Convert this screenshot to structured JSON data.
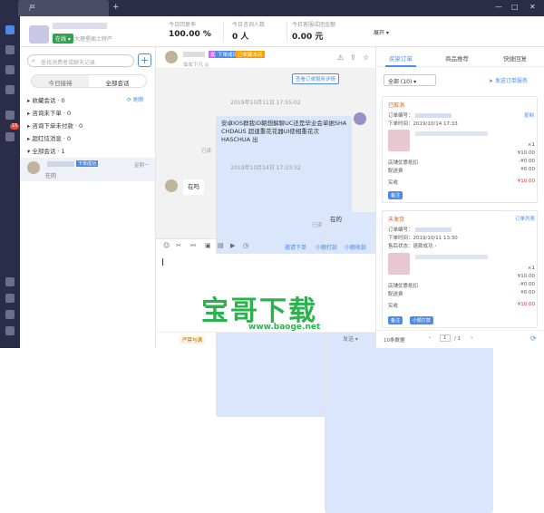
{
  "titlebar": {
    "tab_title": "严",
    "tab_plus": "+",
    "min": "—",
    "max": "□",
    "close": "✕"
  },
  "header": {
    "status": "在线 ▾",
    "shop_sub": "大理堡阁土特产",
    "stats": [
      {
        "label": "今日回复率",
        "value": "100.00 %"
      },
      {
        "label": "今日咨询人数",
        "value": "0 人"
      },
      {
        "label": "今日客服成团金额",
        "value": "0.00 元"
      }
    ],
    "expand": "展开 ▾"
  },
  "left": {
    "search_placeholder": "查找消费者或聊天记录",
    "add": "+",
    "seg": [
      "今日接待",
      "全部会话"
    ],
    "groups": [
      "▸ 收藏会话 · 0",
      "▸ 咨询未下单 · 0",
      "▸ 咨询下单未付款 · 0",
      "▸ 超红炫消息 · 0",
      "▾ 全部会话 · 1"
    ],
    "refresh": "⟳ 刷新",
    "conv": {
      "tag": "下单成功",
      "time": "星期一",
      "msg": "在的"
    }
  },
  "chat": {
    "tag1": "女",
    "tag2": "下单成功",
    "tag3": "已收藏本店",
    "sub": "仙女下凡 ◎",
    "view_btn": "查看订单服务详情",
    "ts1": "2019年10月11日 17:55:02",
    "msg1": "安卓IOS群我ID朝想解聊UC还是毕业会单据SHA CHDAUS 超速重花花器UI使相重花次HASCHUA 出",
    "read1": "已读",
    "ts2": "2019年10月14日 17:33:32",
    "msg2": "在吗",
    "msg3": "在的",
    "read2": "已读",
    "links": [
      "邀请下单",
      "小额打款",
      "小额收款"
    ],
    "tip": "严禁与满",
    "send": "发送 ▾"
  },
  "right": {
    "tabs": [
      "买家订单",
      "商品推荐",
      "快捷回复"
    ],
    "filter": "全部 (10)   ▾",
    "send_link": "➤ 发送订单服务",
    "orders": [
      {
        "status": "已取消",
        "no_label": "订单编号：",
        "time_label": "下单时间：2019/10/14 17:33",
        "copy": "复制",
        "qty": "×1",
        "price1": "¥10.00",
        "price2": "-¥0.00",
        "price3": "¥0.00",
        "rows": [
          "店铺优惠抵扣",
          "配送费"
        ],
        "paid_label": "实收",
        "paid": "¥10.00",
        "note": "备注"
      },
      {
        "status": "未发货",
        "no_label": "订单编号：",
        "time_label": "下单时间：2019/10/11 13:30",
        "after": "售后状态：退款成功 ›",
        "copy": "订单列表",
        "qty": "×1",
        "price1": "¥10.00",
        "price2": "-¥0.00",
        "price3": "¥0.00",
        "rows": [
          "店铺优惠抵扣",
          "配送费"
        ],
        "paid_label": "实收",
        "paid": "¥10.00",
        "note": "备注",
        "note2": "小额打款"
      }
    ],
    "pager": {
      "count": "10条数据",
      "page": "1",
      "total": "/ 1"
    }
  },
  "watermark": {
    "text": "宝哥下载",
    "url": "www.baoge.net"
  },
  "colors": {
    "accent": "#4e8be8",
    "rail": "#2a2c48",
    "online": "#2ea44f",
    "alert": "#e8590c"
  }
}
